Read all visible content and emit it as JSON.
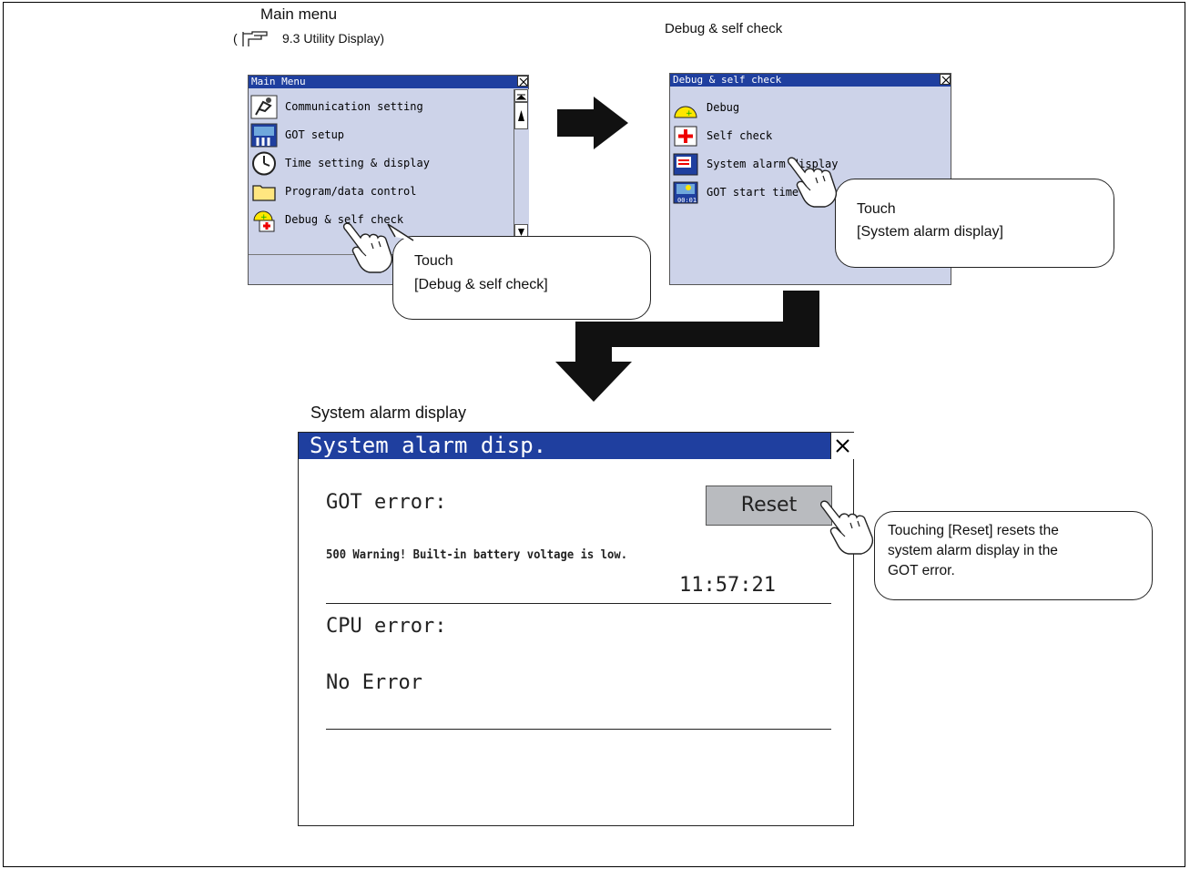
{
  "captions": {
    "main_menu": "Main menu",
    "utility_ref_open": "(",
    "utility_ref": "9.3 Utility Display)",
    "debug_self_check": "Debug & self check",
    "system_alarm_display": "System alarm display"
  },
  "main_menu": {
    "title": "Main Menu",
    "items": [
      {
        "label": "Communication setting",
        "icon": "communication-icon"
      },
      {
        "label": "GOT setup",
        "icon": "got-setup-icon"
      },
      {
        "label": "Time setting & display",
        "icon": "clock-icon"
      },
      {
        "label": "Program/data control",
        "icon": "folder-icon"
      },
      {
        "label": "Debug & self check",
        "icon": "debug-icon"
      }
    ]
  },
  "debug_menu": {
    "title": "Debug & self check",
    "items": [
      {
        "label": "Debug",
        "icon": "debug-icon"
      },
      {
        "label": "Self check",
        "icon": "self-check-icon"
      },
      {
        "label": "System alarm display",
        "icon": "system-alarm-icon"
      },
      {
        "label": "GOT start time",
        "icon": "got-start-time-icon"
      }
    ]
  },
  "callouts": {
    "touch_debug_line1": "Touch",
    "touch_debug_line2": "[Debug & self check]",
    "touch_alarm_line1": "Touch",
    "touch_alarm_line2": "[System alarm display]",
    "reset_line1": "Touching [Reset] resets the",
    "reset_line2": "system alarm display in the",
    "reset_line3": "GOT error."
  },
  "alarm_screen": {
    "title": "System alarm disp.",
    "got_error_label": "GOT error:",
    "reset_label": "Reset",
    "got_error_message": "500 Warning! Built-in battery voltage is low.",
    "got_error_time": "11:57:21",
    "cpu_error_label": "CPU error:",
    "cpu_error_message": "No Error"
  },
  "colors": {
    "titlebar": "#1f3f9f",
    "screen_bg": "#cdd3e9",
    "reset_button": "#b9bbbf"
  }
}
